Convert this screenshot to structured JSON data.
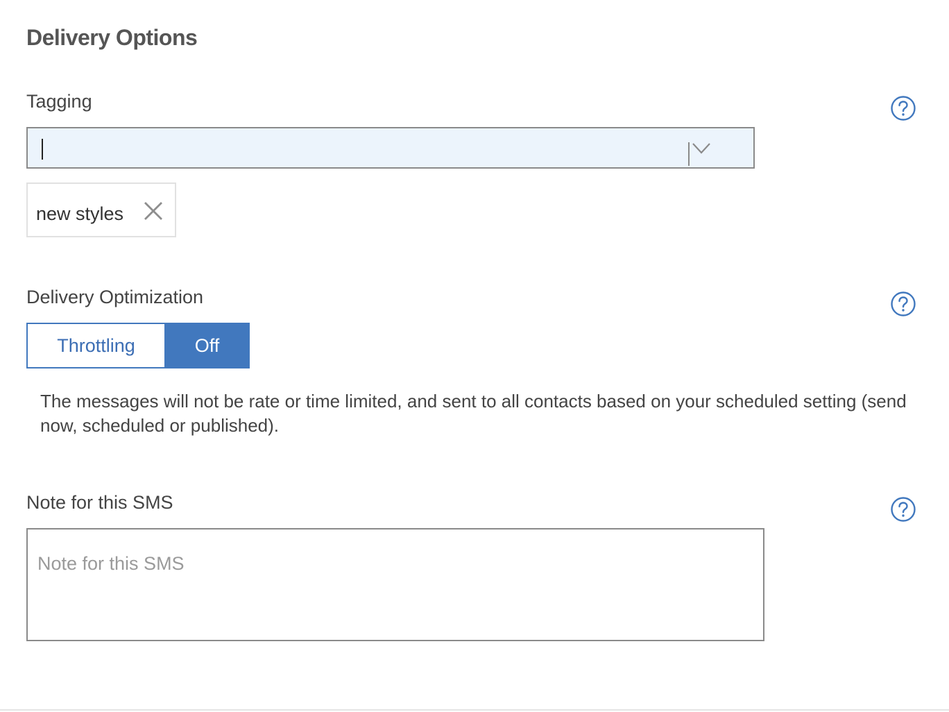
{
  "section": {
    "title": "Delivery Options"
  },
  "tagging": {
    "label": "Tagging",
    "input_value": "",
    "tags": [
      {
        "label": "new styles"
      }
    ]
  },
  "delivery_optimization": {
    "label": "Delivery Optimization",
    "options": {
      "throttling": "Throttling",
      "off": "Off"
    },
    "selected": "Off",
    "description": "The messages will not be rate or time limited, and sent to all contacts based on your scheduled setting (send now, scheduled or published)."
  },
  "note": {
    "label": "Note for this SMS",
    "placeholder": "Note for this SMS",
    "value": ""
  },
  "icons": {
    "help": "help-question-icon",
    "dropdown": "chevron-down-icon",
    "remove_tag": "close-icon"
  },
  "colors": {
    "accent": "#4178be",
    "input_background": "#ecf4fc",
    "border": "#8a8a8a"
  }
}
